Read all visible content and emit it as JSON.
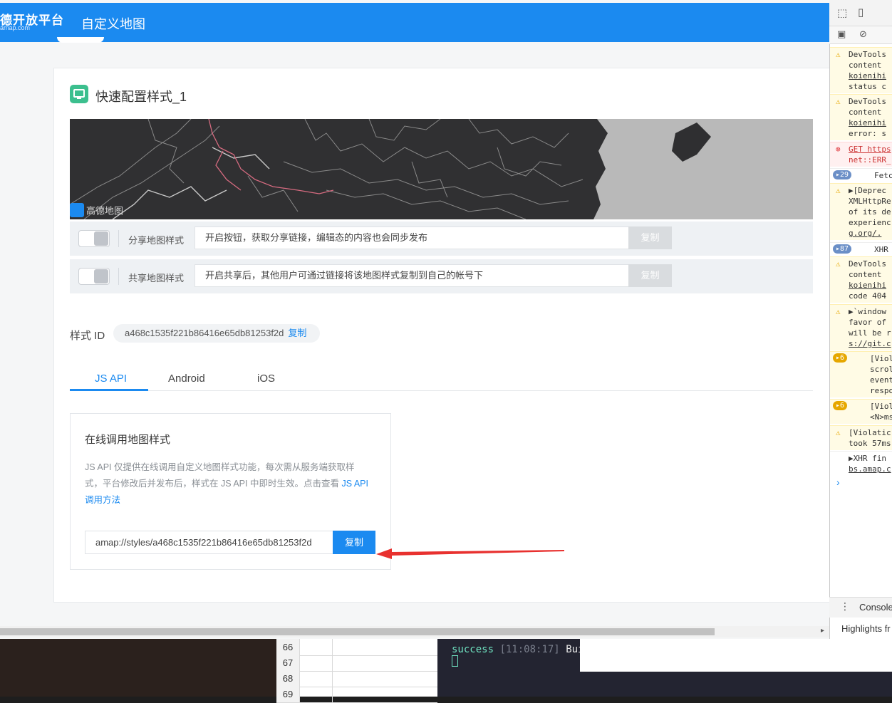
{
  "header": {
    "logo_text": "德开放平台",
    "logo_sub": "amap.com",
    "nav_title": "自定义地图"
  },
  "card": {
    "title": "快速配置样式_1",
    "map_logo": "高德地图"
  },
  "share_row": {
    "label": "分享地图样式",
    "input_text": "开启按钮，获取分享链接，编辑态的内容也会同步发布",
    "button": "复制"
  },
  "public_row": {
    "label": "共享地图样式",
    "input_text": "开启共享后，其他用户可通过链接将该地图样式复制到自己的帐号下",
    "button": "复制"
  },
  "style_id": {
    "label": "样式 ID",
    "value": "a468c1535f221b86416e65db81253f2d",
    "copy": "复制"
  },
  "tabs": [
    {
      "label": "JS API",
      "active": true
    },
    {
      "label": "Android",
      "active": false
    },
    {
      "label": "iOS",
      "active": false
    }
  ],
  "panel": {
    "title": "在线调用地图样式",
    "desc": "JS API 仅提供在线调用自定义地图样式功能，每次需从服务端获取样式，平台修改后并发布后，样式在 JS API 中即时生效。点击查看 ",
    "link": "JS API 调用方法",
    "url_value": "amap://styles/a468c1535f221b86416e65db81253f2d",
    "copy": "复制"
  },
  "devtools": {
    "messages": [
      {
        "type": "warn",
        "lines": [
          "DevTools",
          "content",
          "koienihi",
          "status c"
        ]
      },
      {
        "type": "warn",
        "lines": [
          "DevTools",
          "content",
          "koienihi",
          "error: s"
        ]
      },
      {
        "type": "err",
        "lines": [
          "GET https",
          "net::ERR_"
        ]
      },
      {
        "type": "norm",
        "badge": "29",
        "lines": [
          "Fetc"
        ]
      },
      {
        "type": "warn",
        "lines": [
          "▶[Deprec",
          "XMLHttpRe",
          "of its de",
          "experienc",
          "g.org/."
        ]
      },
      {
        "type": "norm",
        "badge": "87",
        "lines": [
          "XHR"
        ]
      },
      {
        "type": "warn",
        "lines": [
          "DevTools",
          "content",
          "koienihi",
          "code 404"
        ]
      },
      {
        "type": "warn",
        "lines": [
          "▶`window",
          "favor of",
          "will be r",
          "s://git.c"
        ]
      },
      {
        "type": "warn",
        "badge": "6",
        "lines": [
          "[Viol",
          "scrol",
          "event",
          "respo"
        ]
      },
      {
        "type": "warn",
        "badge": "6",
        "lines": [
          "[Viol",
          "<N>ms"
        ]
      },
      {
        "type": "warn",
        "lines": [
          "[Violatic",
          "took 57ms"
        ]
      },
      {
        "type": "norm",
        "lines": [
          "▶XHR fin",
          "bs.amap.c"
        ]
      }
    ],
    "prompt": "›",
    "console_tab": "Console",
    "highlights": "Highlights fr"
  },
  "sheet_rows": [
    "66",
    "67",
    "68",
    "69"
  ],
  "terminal": {
    "status": "success",
    "time": "[11:08:17]",
    "tail": "Bui"
  }
}
